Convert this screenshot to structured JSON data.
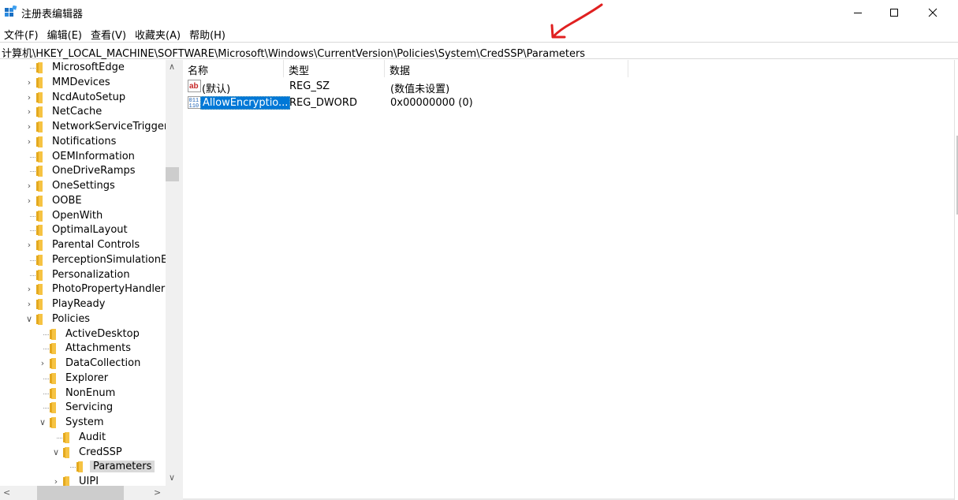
{
  "window": {
    "title": "注册表编辑器",
    "minimize_label": "",
    "maximize_label": "",
    "close_label": ""
  },
  "menu": [
    {
      "label": "文件(F)"
    },
    {
      "label": "编辑(E)"
    },
    {
      "label": "查看(V)"
    },
    {
      "label": "收藏夹(A)"
    },
    {
      "label": "帮助(H)"
    }
  ],
  "address": {
    "path": "计算机\\HKEY_LOCAL_MACHINE\\SOFTWARE\\Microsoft\\Windows\\CurrentVersion\\Policies\\System\\CredSSP\\Parameters"
  },
  "tree": {
    "items": [
      {
        "label": "MicrosoftEdge",
        "level": 0,
        "expander": "leaf"
      },
      {
        "label": "MMDevices",
        "level": 0,
        "expander": "collapsed"
      },
      {
        "label": "NcdAutoSetup",
        "level": 0,
        "expander": "collapsed"
      },
      {
        "label": "NetCache",
        "level": 0,
        "expander": "collapsed"
      },
      {
        "label": "NetworkServiceTriggers",
        "level": 0,
        "expander": "collapsed"
      },
      {
        "label": "Notifications",
        "level": 0,
        "expander": "collapsed"
      },
      {
        "label": "OEMInformation",
        "level": 0,
        "expander": "leaf"
      },
      {
        "label": "OneDriveRamps",
        "level": 0,
        "expander": "leaf"
      },
      {
        "label": "OneSettings",
        "level": 0,
        "expander": "collapsed"
      },
      {
        "label": "OOBE",
        "level": 0,
        "expander": "collapsed"
      },
      {
        "label": "OpenWith",
        "level": 0,
        "expander": "leaf"
      },
      {
        "label": "OptimalLayout",
        "level": 0,
        "expander": "leaf"
      },
      {
        "label": "Parental Controls",
        "level": 0,
        "expander": "collapsed"
      },
      {
        "label": "PerceptionSimulationExtensions",
        "level": 0,
        "expander": "leaf"
      },
      {
        "label": "Personalization",
        "level": 0,
        "expander": "leaf"
      },
      {
        "label": "PhotoPropertyHandler",
        "level": 0,
        "expander": "collapsed"
      },
      {
        "label": "PlayReady",
        "level": 0,
        "expander": "collapsed"
      },
      {
        "label": "Policies",
        "level": 0,
        "expander": "expanded"
      },
      {
        "label": "ActiveDesktop",
        "level": 1,
        "expander": "leaf"
      },
      {
        "label": "Attachments",
        "level": 1,
        "expander": "leaf"
      },
      {
        "label": "DataCollection",
        "level": 1,
        "expander": "collapsed"
      },
      {
        "label": "Explorer",
        "level": 1,
        "expander": "leaf"
      },
      {
        "label": "NonEnum",
        "level": 1,
        "expander": "leaf"
      },
      {
        "label": "Servicing",
        "level": 1,
        "expander": "leaf"
      },
      {
        "label": "System",
        "level": 1,
        "expander": "expanded"
      },
      {
        "label": "Audit",
        "level": 2,
        "expander": "leaf"
      },
      {
        "label": "CredSSP",
        "level": 2,
        "expander": "expanded"
      },
      {
        "label": "Parameters",
        "level": 3,
        "expander": "leaf",
        "selected": true
      },
      {
        "label": "UIPI",
        "level": 2,
        "expander": "collapsed"
      }
    ]
  },
  "list": {
    "columns": [
      {
        "label": "名称"
      },
      {
        "label": "类型"
      },
      {
        "label": "数据"
      }
    ],
    "rows": [
      {
        "icon": "string-value-icon",
        "name": "(默认)",
        "type": "REG_SZ",
        "data": "(数值未设置)",
        "selected": false
      },
      {
        "icon": "binary-value-icon",
        "name": "AllowEncryptio...",
        "type": "REG_DWORD",
        "data": "0x00000000 (0)",
        "selected": true
      }
    ]
  },
  "colors": {
    "selection": "#0078d7",
    "folder": "#f6c343",
    "annotation": "#e02020"
  }
}
